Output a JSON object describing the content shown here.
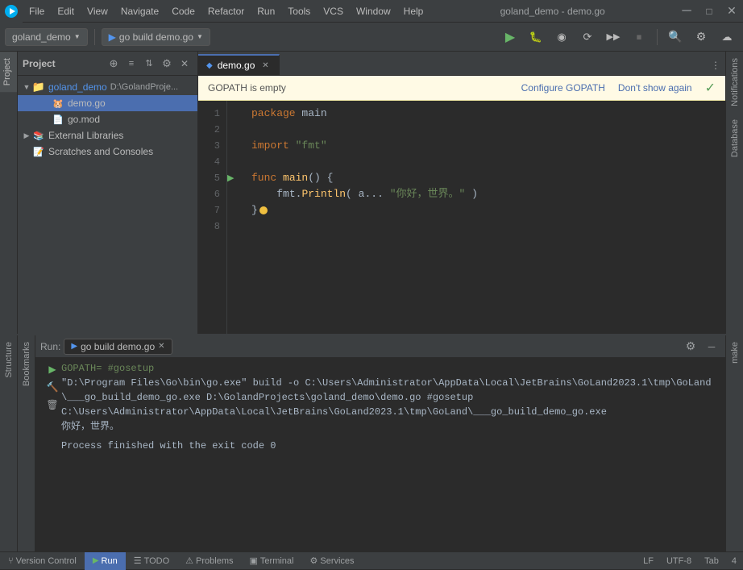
{
  "app": {
    "title": "goland_demo - demo.go",
    "logo": "▶"
  },
  "menubar": {
    "items": [
      "File",
      "Edit",
      "View",
      "Navigate",
      "Code",
      "Refactor",
      "Run",
      "Tools",
      "VCS",
      "Window",
      "Help"
    ]
  },
  "toolbar": {
    "project_btn": "goland_demo",
    "project_path": "D:\\GolandProje...",
    "run_config": "go build demo.go",
    "icons": [
      "▶",
      "🐛",
      "⟳",
      "⟳",
      "⏹",
      "🔍",
      "⚙",
      "☁"
    ]
  },
  "project_panel": {
    "title": "Project",
    "root": {
      "name": "goland_demo",
      "path": "D:\\GolandProje...",
      "children": [
        {
          "name": "demo.go",
          "type": "go"
        },
        {
          "name": "go.mod",
          "type": "mod"
        }
      ]
    },
    "external": "External Libraries",
    "scratches": "Scratches and Consoles"
  },
  "editor": {
    "tab": "demo.go",
    "notification": {
      "text": "GOPATH is empty",
      "configure_link": "Configure GOPATH",
      "dismiss_link": "Don't show again"
    },
    "lines": [
      {
        "num": 1,
        "content": "package main",
        "type": "code"
      },
      {
        "num": 2,
        "content": "",
        "type": "empty"
      },
      {
        "num": 3,
        "content": "import \"fmt\"",
        "type": "code"
      },
      {
        "num": 4,
        "content": "",
        "type": "empty"
      },
      {
        "num": 5,
        "content": "func main() {",
        "type": "code",
        "has_arrow": true
      },
      {
        "num": 6,
        "content": "    fmt.Println( a... \"你好，世界。\" )",
        "type": "code"
      },
      {
        "num": 7,
        "content": "}",
        "type": "code",
        "has_debug": true
      },
      {
        "num": 8,
        "content": "",
        "type": "empty"
      }
    ]
  },
  "right_sidebar": {
    "items": [
      "Notifications",
      "Database"
    ]
  },
  "bottom_panel": {
    "run_label": "Run:",
    "run_tab": "go build demo.go",
    "output": [
      {
        "type": "cmd-arrow",
        "text": "GOPATH= #gosetup"
      },
      {
        "type": "build-cmd",
        "text": "\"D:\\Program Files\\Go\\bin\\go.exe\" build -o C:\\Users\\Administrator\\AppData\\Local\\JetBrains\\GoLand2023.1\\tmp\\GoLand\\___go_build_demo_go.exe D:\\GolandProjects\\goland_demo\\demo.go #gosetup"
      },
      {
        "type": "build-cmd",
        "text": "C:\\Users\\Administrator\\AppData\\Local\\JetBrains\\GoLand2023.1\\tmp\\GoLand\\___go_build_demo_go.exe"
      },
      {
        "type": "result",
        "text": "你好，世界。"
      },
      {
        "type": "empty",
        "text": ""
      },
      {
        "type": "process",
        "text": "Process finished with the exit code 0"
      }
    ]
  },
  "status_bar": {
    "tabs": [
      {
        "label": "Version Control",
        "icon": ""
      },
      {
        "label": "Run",
        "icon": "▶",
        "active": true
      },
      {
        "label": "TODO",
        "icon": "☰"
      },
      {
        "label": "Problems",
        "icon": "⚠"
      },
      {
        "label": "Terminal",
        "icon": "⬛"
      },
      {
        "label": "Services",
        "icon": "⚙"
      }
    ],
    "right_items": [
      "LF",
      "UTF-8",
      "Tab",
      "4"
    ]
  },
  "left_panels": {
    "project_label": "Project",
    "structure_label": "Structure",
    "bookmarks_label": "Bookmarks"
  },
  "right_panels": {
    "make_label": "make"
  }
}
